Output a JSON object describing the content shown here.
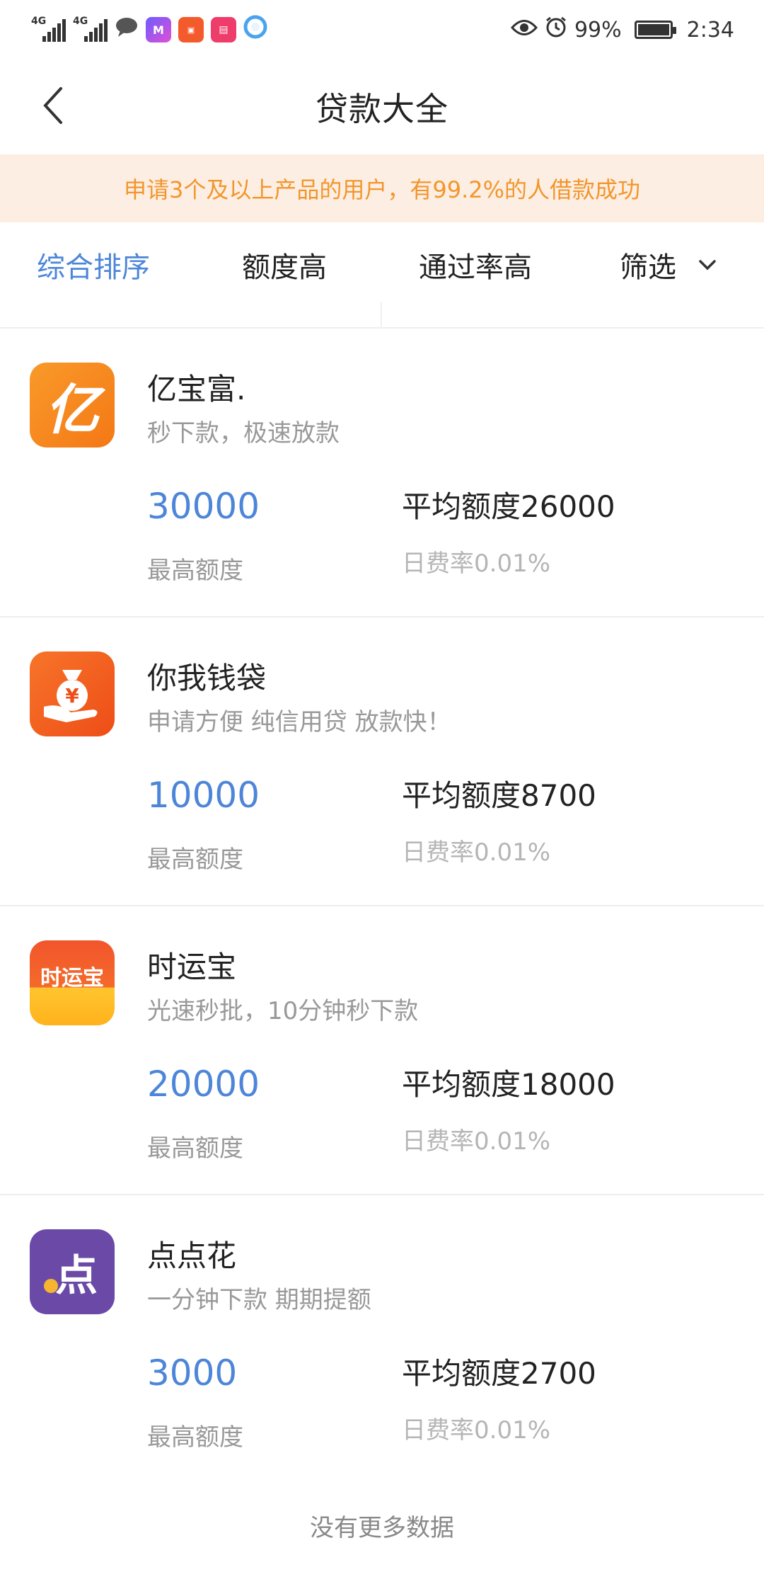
{
  "status_bar": {
    "signal1_tag": "4G",
    "signal2_tag": "4G",
    "battery_percent": "99%",
    "time": "2:34"
  },
  "nav": {
    "title": "贷款大全"
  },
  "banner": {
    "text": "申请3个及以上产品的用户，有99.2%的人借款成功"
  },
  "sort_bar": {
    "items": [
      {
        "label": "综合排序"
      },
      {
        "label": "额度高"
      },
      {
        "label": "通过率高"
      },
      {
        "label": "筛选"
      }
    ]
  },
  "loans": [
    {
      "name": "亿宝富.",
      "slogan": "秒下款，极速放款",
      "max_amount": "30000",
      "max_label": "最高额度",
      "avg": "平均额度26000",
      "rate": "日费率0.01%",
      "logo_text": "亿",
      "logo_color": "#f58a1f"
    },
    {
      "name": "你我钱袋",
      "slogan": "申请方便 纯信用贷 放款快！",
      "max_amount": "10000",
      "max_label": "最高额度",
      "avg": "平均额度8700",
      "rate": "日费率0.01%",
      "logo_text": "¥",
      "logo_color": "#f26b1c"
    },
    {
      "name": "时运宝",
      "slogan": "光速秒批，10分钟秒下款",
      "max_amount": "20000",
      "max_label": "最高额度",
      "avg": "平均额度18000",
      "rate": "日费率0.01%",
      "logo_text": "时运宝",
      "logo_color": "#f2552c"
    },
    {
      "name": "点点花",
      "slogan": "一分钟下款 期期提额",
      "max_amount": "3000",
      "max_label": "最高额度",
      "avg": "平均额度2700",
      "rate": "日费率0.01%",
      "logo_text": "点",
      "logo_color": "#6a4aa6"
    }
  ],
  "footer": {
    "text": "没有更多数据"
  },
  "colors": {
    "accent_blue": "#4d86d8",
    "banner_bg": "#fdeee3",
    "banner_text": "#f2962c"
  }
}
